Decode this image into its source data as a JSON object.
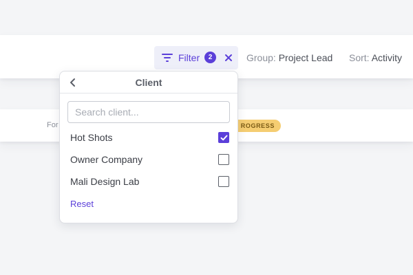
{
  "toolbar": {
    "filter_label": "Filter",
    "filter_count": "2",
    "group_label": "Group:",
    "group_value": "Project Lead",
    "sort_label": "Sort:",
    "sort_value": "Activity"
  },
  "row": {
    "for_text": "For",
    "status_text": "ROGRESS"
  },
  "dropdown": {
    "title": "Client",
    "search_placeholder": "Search client...",
    "items": [
      {
        "label": "Hot Shots",
        "checked": true
      },
      {
        "label": "Owner Company",
        "checked": false
      },
      {
        "label": "Mali Design Lab",
        "checked": false
      }
    ],
    "reset_label": "Reset"
  },
  "colors": {
    "accent": "#5b3fd9",
    "status_yellow": "#f5cd72"
  },
  "icons": {
    "filter": "filter-icon",
    "clear": "close-icon",
    "back": "chevron-left-icon",
    "check": "checkmark-icon"
  }
}
